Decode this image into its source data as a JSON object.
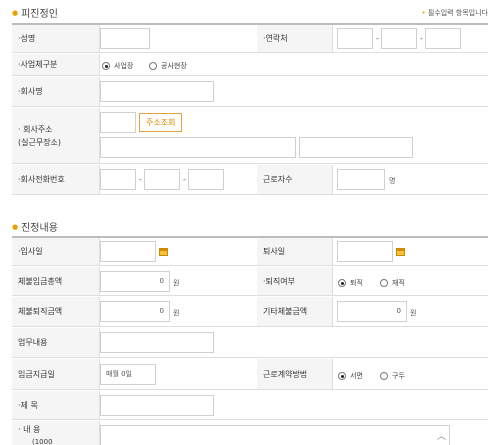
{
  "section1": {
    "title": "피진정인",
    "required_note": "필수입력 항목입니다"
  },
  "section2": {
    "title": "진정내용"
  },
  "fields": {
    "name": "성명",
    "contact": "연락처",
    "biz_type": "사업체구분",
    "biz_type_options": [
      "사업장",
      "공사현장"
    ],
    "company_name": "회사명",
    "company_address_line1": "회사주소",
    "company_address_line2": "(실근무장소)",
    "address_search_button": "주소조회",
    "company_phone": "회사전화번호",
    "employee_count": "근로자수",
    "employee_unit": "명",
    "join_date": "입사일",
    "leave_date": "퇴사일",
    "unpaid_wage": "체불임금총액",
    "unpaid_wage_value": "0",
    "won": "원",
    "retire_status": "퇴직여부",
    "retire_options": [
      "퇴직",
      "재직"
    ],
    "unpaid_severance": "체불퇴직금액",
    "unpaid_severance_value": "0",
    "other_unpaid": "기타체불금액",
    "other_unpaid_value": "0",
    "job_desc": "업무내용",
    "pay_day": "임금지급일",
    "pay_day_value": "매월 0일",
    "contract_method": "근로계약방법",
    "contract_options": [
      "서면",
      "구두"
    ],
    "subject": "제 목",
    "content": "내 용",
    "content_sub": "(1000"
  },
  "dashes": "-",
  "colors": {
    "accent": "#e8a200",
    "button_text": "#d98a00"
  },
  "icons": {
    "calendar": "calendar-icon",
    "scroll_up": "chevron-up-icon"
  }
}
